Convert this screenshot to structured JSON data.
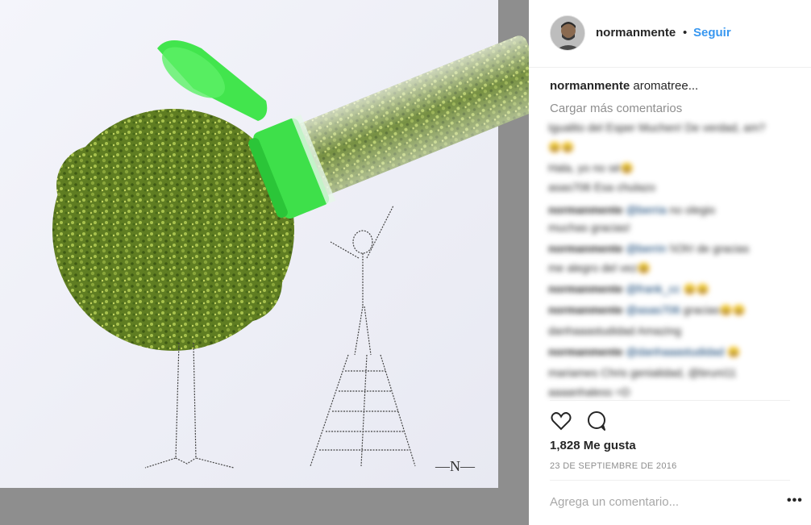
{
  "post": {
    "username": "normanmente",
    "dot": "•",
    "follow_label": "Seguir",
    "caption_user": "normanmente",
    "caption_text": "aromatree...",
    "load_more_label": "Cargar más comentarios",
    "comments": [
      {
        "user": "",
        "text": "Igualito del Esper Muchen! De verdad, am?"
      },
      {
        "user": "",
        "text": "",
        "emoji": "😀😀"
      },
      {
        "user": "",
        "text": "Hala, yo no sé",
        "emoji": "😃"
      },
      {
        "user": "",
        "text": "asas706 Esa chulazo"
      },
      {
        "user": "normanmente",
        "text": "no olegio",
        "mention": "@berria"
      },
      {
        "user": "",
        "text": "muchas gracias!"
      },
      {
        "user": "normanmente",
        "text": "\\\\Oh! de gracias",
        "mention": "@berrin"
      },
      {
        "user": "",
        "text": "me alegro del vez",
        "emoji": "😃"
      },
      {
        "user": "normanmente",
        "text": "",
        "mention": "@frank_cc",
        "emoji": "😀😀"
      },
      {
        "user": "normanmente",
        "text": "gracias",
        "mention": "@asas706",
        "emoji": "😀😀"
      },
      {
        "user": "",
        "text": "danhaaastudidad Amazing"
      },
      {
        "user": "normanmente",
        "text": "",
        "mention": "@danhaaastudidad",
        "emoji": "😀"
      },
      {
        "user": "",
        "text": "mariames Chris genialidad, @bruni11"
      },
      {
        "user": "",
        "text": "aaaanhaless =D"
      }
    ],
    "likes_label": "1,828 Me gusta",
    "date_label": "23 DE SEPTIEMBRE DE 2016",
    "comment_placeholder": "Agrega un comentario...",
    "more_label": "•••"
  },
  "photo": {
    "signature_text": "—N—",
    "icons": {
      "heart": "heart-icon",
      "comment": "comment-bubble-icon",
      "more": "more-options-icon"
    }
  }
}
